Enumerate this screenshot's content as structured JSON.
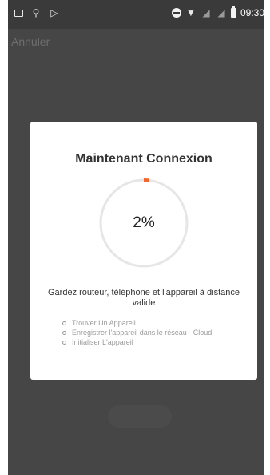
{
  "status_bar": {
    "time": "09:30",
    "icons": [
      "photo-icon",
      "usb-icon",
      "play-icon",
      "dnd-icon",
      "wifi-icon",
      "signal-icon",
      "signal-icon",
      "battery-icon"
    ]
  },
  "header": {
    "cancel_label": "Annuler"
  },
  "dialog": {
    "title": "Maintenant Connexion",
    "progress_label": "2%",
    "progress_value": 0.02,
    "hint": "Gardez routeur, téléphone et l'appareil à distance valide",
    "steps": [
      "Trouver Un Appareil",
      "Enregistrer l'appareil dans le réseau - Cloud",
      "Initialiser L'appareil"
    ]
  },
  "colors": {
    "overlay": "#464646",
    "dialog_bg": "#ffffff",
    "ring_track": "#e6e6e6",
    "ring_progress": "#f2662b",
    "step_text": "#9a9a9a"
  }
}
